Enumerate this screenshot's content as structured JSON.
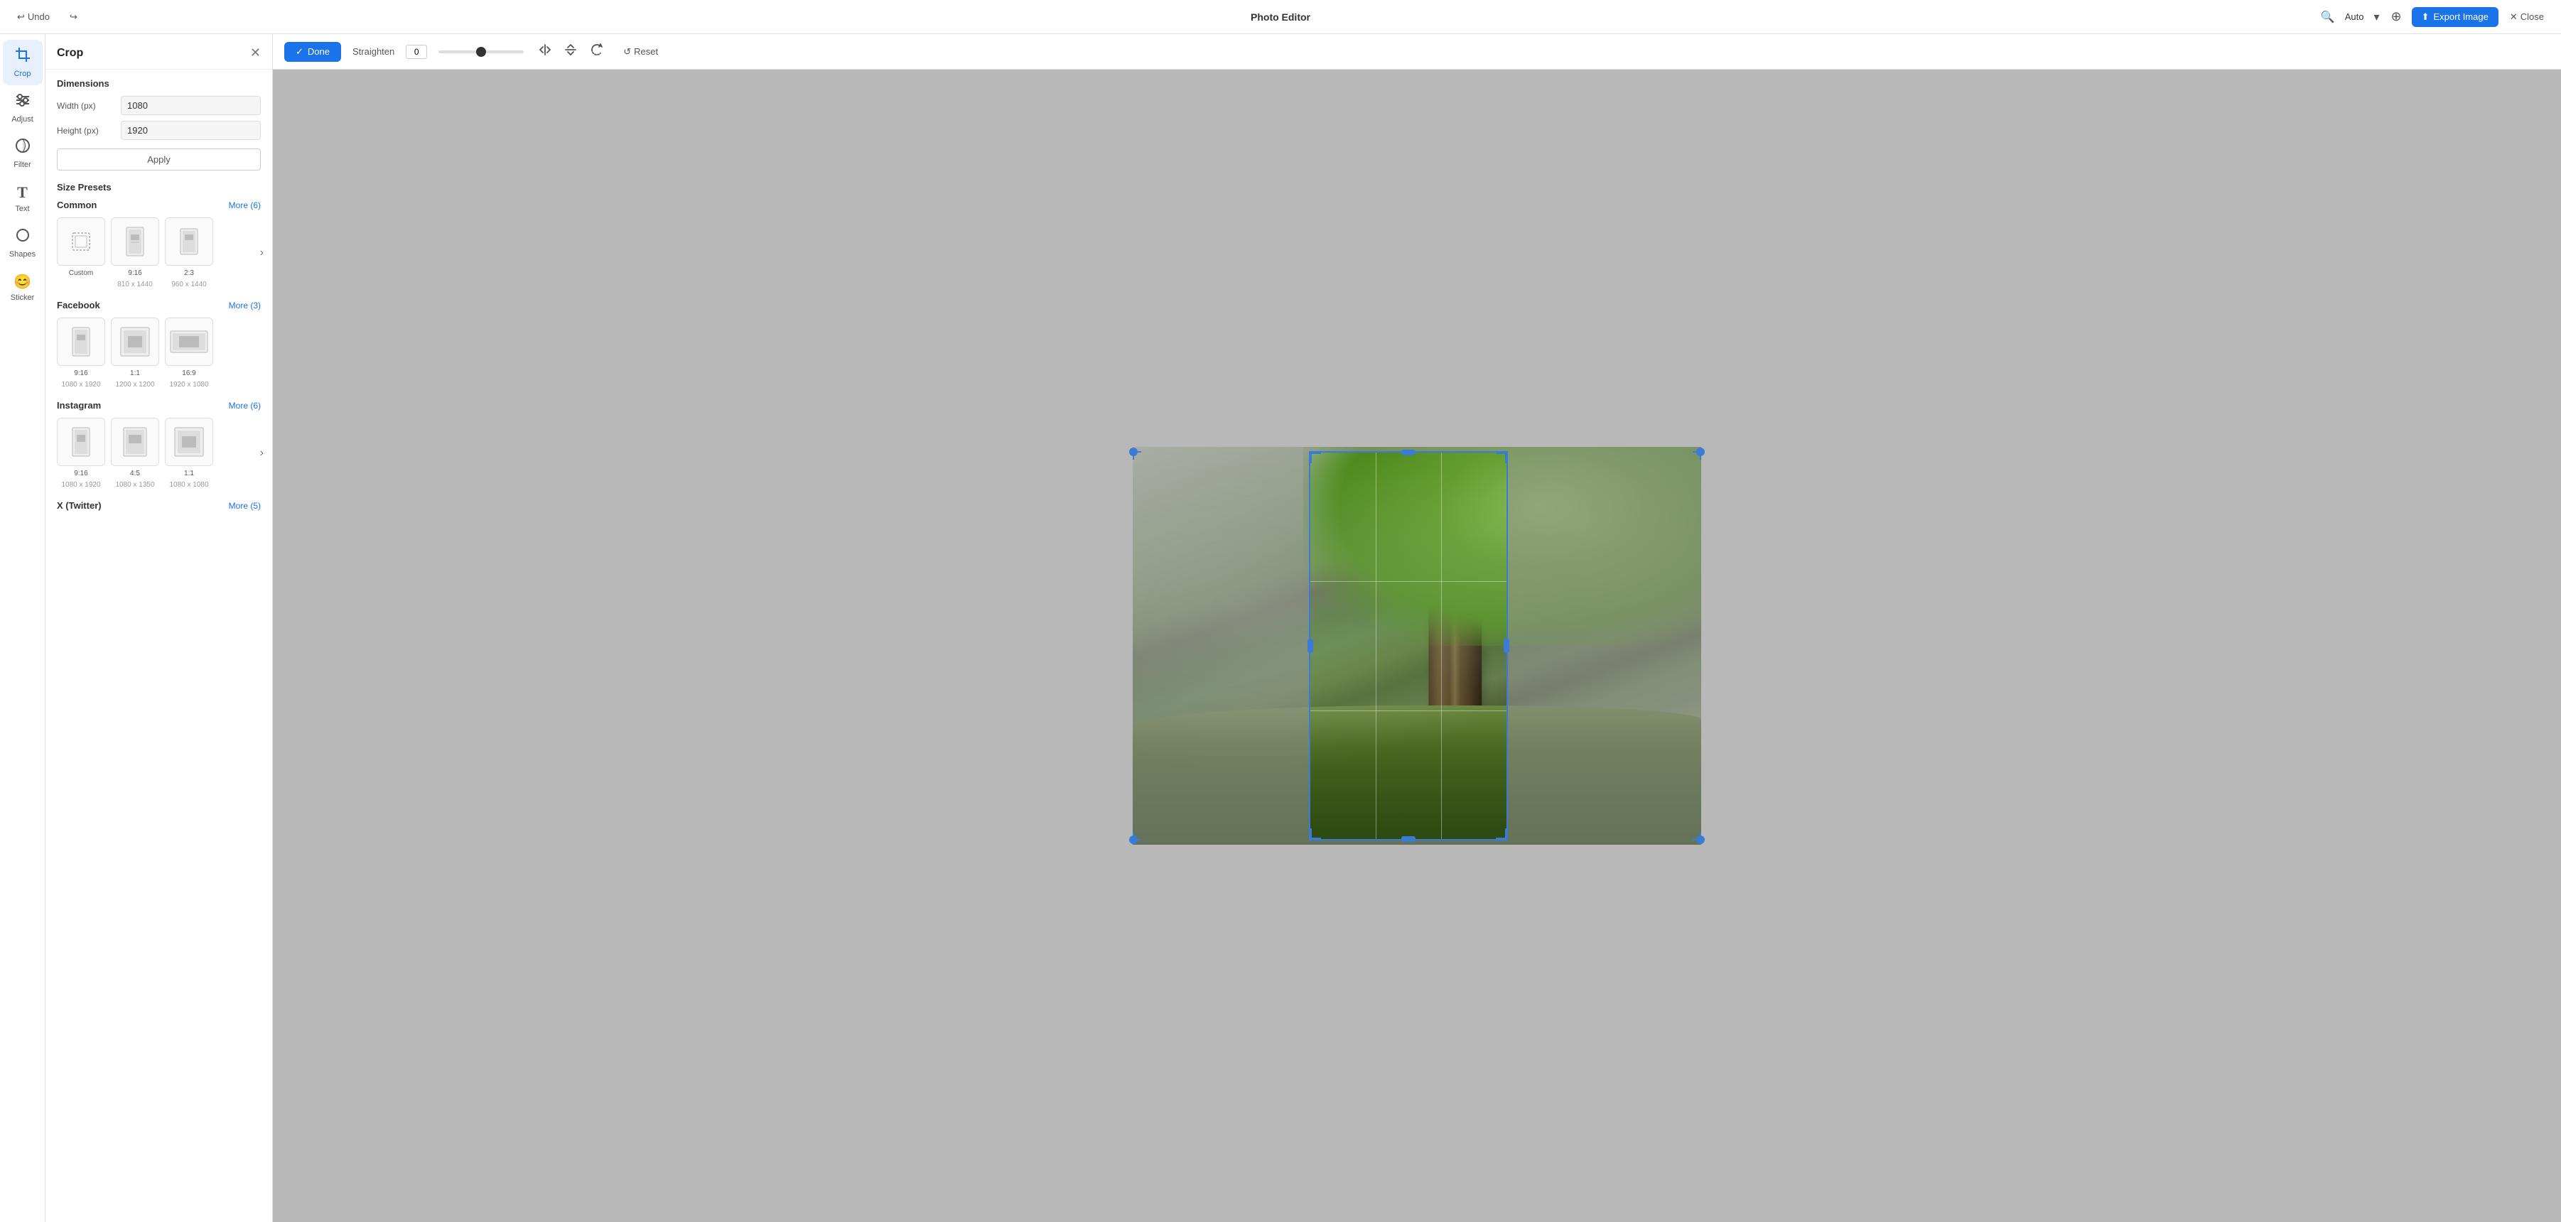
{
  "app": {
    "title": "Photo Editor"
  },
  "topbar": {
    "undo_label": "Undo",
    "redo_label": "",
    "zoom_value": "Auto",
    "export_label": "Export Image",
    "close_label": "Close"
  },
  "toolbar": {
    "done_label": "Done",
    "straighten_label": "Straighten",
    "straighten_value": "0",
    "reset_label": "Reset"
  },
  "panel": {
    "title": "Crop",
    "dimensions_label": "Dimensions",
    "width_label": "Width (px)",
    "height_label": "Height (px)",
    "width_value": "1080",
    "height_value": "1920",
    "apply_label": "Apply",
    "size_presets_label": "Size Presets",
    "common_label": "Common",
    "common_more": "More (6)",
    "facebook_label": "Facebook",
    "facebook_more": "More (3)",
    "instagram_label": "Instagram",
    "instagram_more": "More (6)",
    "twitter_label": "X (Twitter)",
    "twitter_more": "More (5)",
    "presets_common": [
      {
        "label": "Custom",
        "sublabel": ""
      },
      {
        "label": "9:16",
        "sublabel": "810 x 1440"
      },
      {
        "label": "2:3",
        "sublabel": "960 x 1440"
      }
    ],
    "presets_facebook": [
      {
        "label": "9:16",
        "sublabel": "1080 x 1920"
      },
      {
        "label": "1:1",
        "sublabel": "1200 x 1200"
      },
      {
        "label": "16:9",
        "sublabel": "1920 x 1080"
      }
    ],
    "presets_instagram": [
      {
        "label": "9:16",
        "sublabel": "1080 x 1920"
      },
      {
        "label": "4:5",
        "sublabel": "1080 x 1350"
      },
      {
        "label": "1:1",
        "sublabel": "1080 x 1080"
      }
    ]
  },
  "tools": [
    {
      "id": "crop",
      "label": "Crop",
      "active": true
    },
    {
      "id": "adjust",
      "label": "Adjust",
      "active": false
    },
    {
      "id": "filter",
      "label": "Filter",
      "active": false
    },
    {
      "id": "text",
      "label": "Text",
      "active": false
    },
    {
      "id": "shapes",
      "label": "Shapes",
      "active": false
    },
    {
      "id": "sticker",
      "label": "Sticker",
      "active": false
    }
  ],
  "colors": {
    "accent": "#1a73e8",
    "border": "#e0e0e0",
    "crop_border": "#3a7bd5",
    "overlay": "rgba(150,150,150,0.55)"
  }
}
